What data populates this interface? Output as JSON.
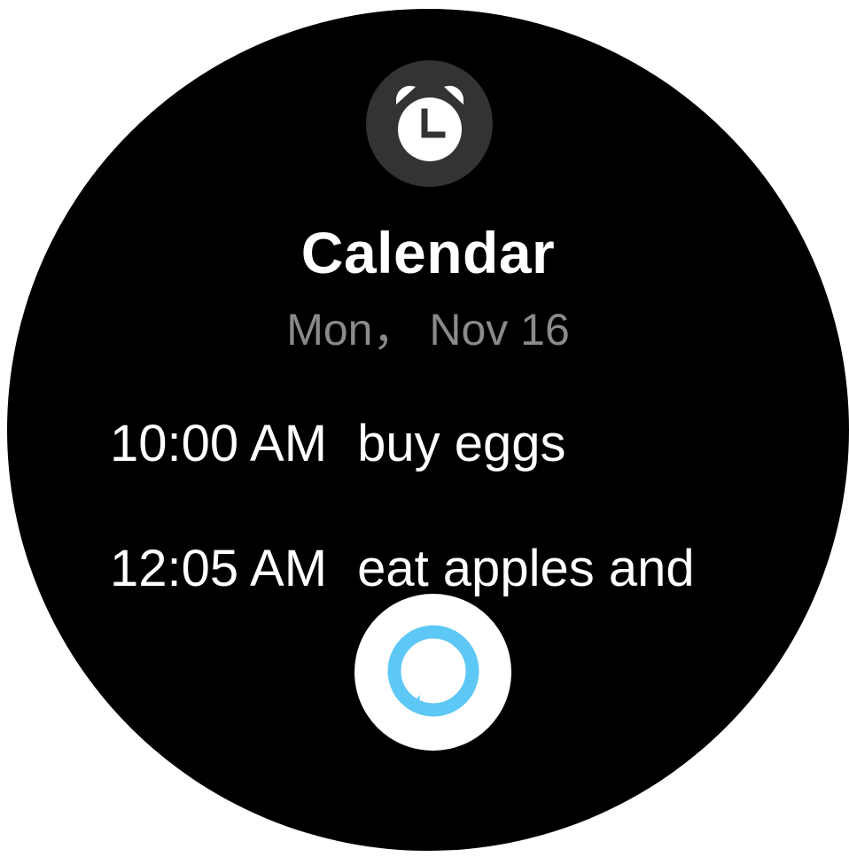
{
  "app": {
    "title": "Calendar",
    "date": "Mon， Nov 16"
  },
  "events": [
    {
      "time": "10:00 AM",
      "title": "buy eggs"
    },
    {
      "time": "12:05 AM",
      "title": "eat apples and"
    }
  ],
  "icons": {
    "top": "alarm-clock-icon",
    "bottom": "alexa-ring-icon"
  },
  "colors": {
    "background": "#000000",
    "title": "#ffffff",
    "date": "#8a8a8a",
    "badge": "#333333",
    "assistant_ring": "#5dc8f5"
  }
}
